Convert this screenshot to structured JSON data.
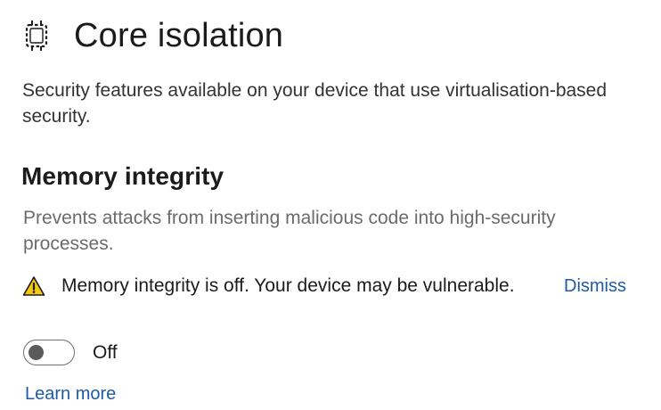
{
  "header": {
    "icon": "core-isolation-chip-icon",
    "title": "Core isolation"
  },
  "description": "Security features available on your device that use virtualisation-based security.",
  "memory_integrity": {
    "title": "Memory integrity",
    "description": "Prevents attacks from inserting malicious code into high-security processes.",
    "warning": {
      "icon": "warning-triangle-icon",
      "text": "Memory integrity is off. Your device may be vulnerable.",
      "dismiss_label": "Dismiss"
    },
    "toggle": {
      "state": "off",
      "label": "Off"
    },
    "learn_more_label": "Learn more"
  },
  "colors": {
    "link": "#1f5aa8",
    "warning_fill": "#f2c811",
    "secondary_text": "#6b6b6b"
  }
}
